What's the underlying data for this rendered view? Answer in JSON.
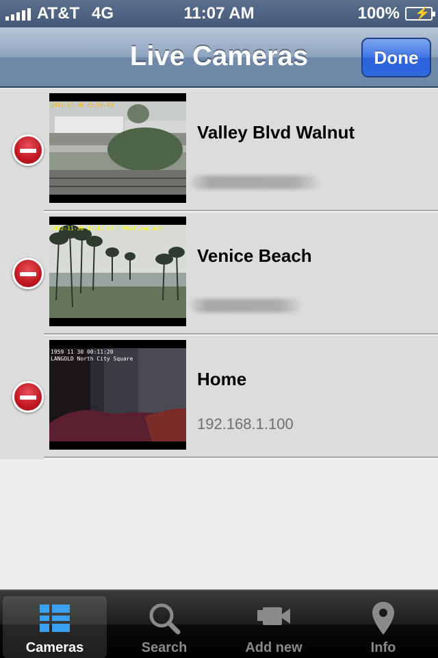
{
  "status_bar": {
    "carrier": "AT&T",
    "network": "4G",
    "time": "11:07 AM",
    "battery": "100%"
  },
  "nav": {
    "title": "Live Cameras",
    "done_label": "Done"
  },
  "cameras": [
    {
      "name": "Valley Blvd Walnut",
      "address": "",
      "address_blurred": true,
      "stamp": "2012-11-30 15:56:49",
      "stamp_color": "#ffb000"
    },
    {
      "name": "Venice Beach",
      "address": "",
      "address_blurred": true,
      "stamp": "2012-11-30 03:47:45 - Westland.net",
      "stamp_color": "#ffff00"
    },
    {
      "name": "Home",
      "address": "192.168.1.100",
      "address_blurred": false,
      "stamp": "1959 11 30 00:11:20\nLANGOLD North City Square",
      "stamp_color": "#ffffff"
    }
  ],
  "tabs": [
    {
      "label": "Cameras",
      "icon": "grid-icon",
      "active": true
    },
    {
      "label": "Search",
      "icon": "magnifier-icon",
      "active": false
    },
    {
      "label": "Add new",
      "icon": "video-camera-icon",
      "active": false
    },
    {
      "label": "Info",
      "icon": "map-pin-icon",
      "active": false
    }
  ],
  "colors": {
    "delete": "#c01822",
    "done_button": "#3d75e6",
    "active_tab_icon": "#3aa0f0"
  }
}
